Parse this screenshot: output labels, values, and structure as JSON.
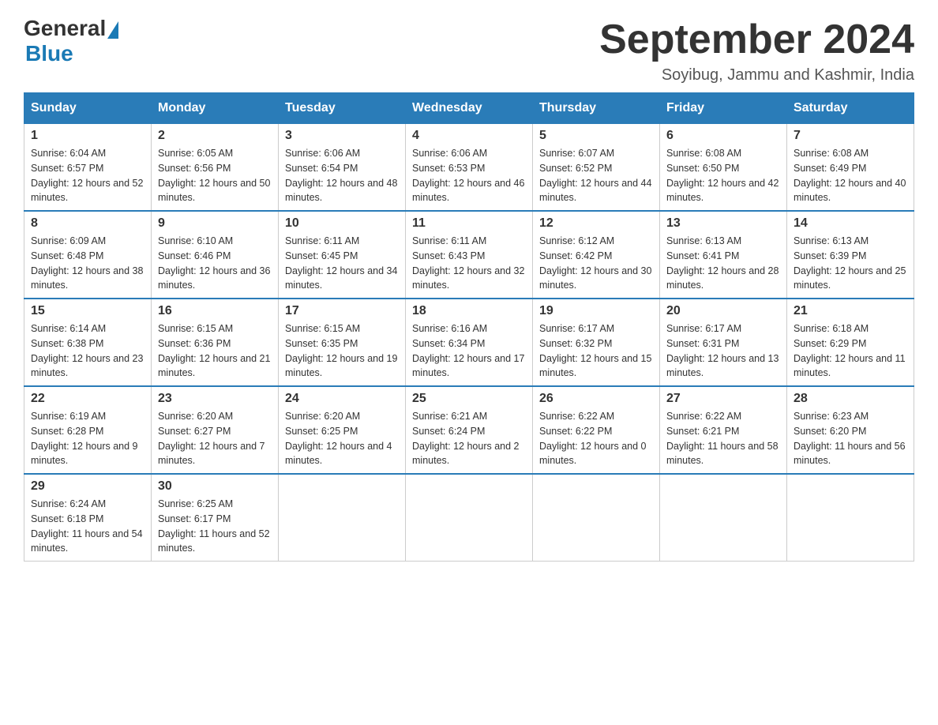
{
  "header": {
    "logo_general": "General",
    "logo_blue": "Blue",
    "month_title": "September 2024",
    "location": "Soyibug, Jammu and Kashmir, India"
  },
  "days_of_week": [
    "Sunday",
    "Monday",
    "Tuesday",
    "Wednesday",
    "Thursday",
    "Friday",
    "Saturday"
  ],
  "weeks": [
    [
      {
        "day": "1",
        "sunrise": "6:04 AM",
        "sunset": "6:57 PM",
        "daylight": "12 hours and 52 minutes."
      },
      {
        "day": "2",
        "sunrise": "6:05 AM",
        "sunset": "6:56 PM",
        "daylight": "12 hours and 50 minutes."
      },
      {
        "day": "3",
        "sunrise": "6:06 AM",
        "sunset": "6:54 PM",
        "daylight": "12 hours and 48 minutes."
      },
      {
        "day": "4",
        "sunrise": "6:06 AM",
        "sunset": "6:53 PM",
        "daylight": "12 hours and 46 minutes."
      },
      {
        "day": "5",
        "sunrise": "6:07 AM",
        "sunset": "6:52 PM",
        "daylight": "12 hours and 44 minutes."
      },
      {
        "day": "6",
        "sunrise": "6:08 AM",
        "sunset": "6:50 PM",
        "daylight": "12 hours and 42 minutes."
      },
      {
        "day": "7",
        "sunrise": "6:08 AM",
        "sunset": "6:49 PM",
        "daylight": "12 hours and 40 minutes."
      }
    ],
    [
      {
        "day": "8",
        "sunrise": "6:09 AM",
        "sunset": "6:48 PM",
        "daylight": "12 hours and 38 minutes."
      },
      {
        "day": "9",
        "sunrise": "6:10 AM",
        "sunset": "6:46 PM",
        "daylight": "12 hours and 36 minutes."
      },
      {
        "day": "10",
        "sunrise": "6:11 AM",
        "sunset": "6:45 PM",
        "daylight": "12 hours and 34 minutes."
      },
      {
        "day": "11",
        "sunrise": "6:11 AM",
        "sunset": "6:43 PM",
        "daylight": "12 hours and 32 minutes."
      },
      {
        "day": "12",
        "sunrise": "6:12 AM",
        "sunset": "6:42 PM",
        "daylight": "12 hours and 30 minutes."
      },
      {
        "day": "13",
        "sunrise": "6:13 AM",
        "sunset": "6:41 PM",
        "daylight": "12 hours and 28 minutes."
      },
      {
        "day": "14",
        "sunrise": "6:13 AM",
        "sunset": "6:39 PM",
        "daylight": "12 hours and 25 minutes."
      }
    ],
    [
      {
        "day": "15",
        "sunrise": "6:14 AM",
        "sunset": "6:38 PM",
        "daylight": "12 hours and 23 minutes."
      },
      {
        "day": "16",
        "sunrise": "6:15 AM",
        "sunset": "6:36 PM",
        "daylight": "12 hours and 21 minutes."
      },
      {
        "day": "17",
        "sunrise": "6:15 AM",
        "sunset": "6:35 PM",
        "daylight": "12 hours and 19 minutes."
      },
      {
        "day": "18",
        "sunrise": "6:16 AM",
        "sunset": "6:34 PM",
        "daylight": "12 hours and 17 minutes."
      },
      {
        "day": "19",
        "sunrise": "6:17 AM",
        "sunset": "6:32 PM",
        "daylight": "12 hours and 15 minutes."
      },
      {
        "day": "20",
        "sunrise": "6:17 AM",
        "sunset": "6:31 PM",
        "daylight": "12 hours and 13 minutes."
      },
      {
        "day": "21",
        "sunrise": "6:18 AM",
        "sunset": "6:29 PM",
        "daylight": "12 hours and 11 minutes."
      }
    ],
    [
      {
        "day": "22",
        "sunrise": "6:19 AM",
        "sunset": "6:28 PM",
        "daylight": "12 hours and 9 minutes."
      },
      {
        "day": "23",
        "sunrise": "6:20 AM",
        "sunset": "6:27 PM",
        "daylight": "12 hours and 7 minutes."
      },
      {
        "day": "24",
        "sunrise": "6:20 AM",
        "sunset": "6:25 PM",
        "daylight": "12 hours and 4 minutes."
      },
      {
        "day": "25",
        "sunrise": "6:21 AM",
        "sunset": "6:24 PM",
        "daylight": "12 hours and 2 minutes."
      },
      {
        "day": "26",
        "sunrise": "6:22 AM",
        "sunset": "6:22 PM",
        "daylight": "12 hours and 0 minutes."
      },
      {
        "day": "27",
        "sunrise": "6:22 AM",
        "sunset": "6:21 PM",
        "daylight": "11 hours and 58 minutes."
      },
      {
        "day": "28",
        "sunrise": "6:23 AM",
        "sunset": "6:20 PM",
        "daylight": "11 hours and 56 minutes."
      }
    ],
    [
      {
        "day": "29",
        "sunrise": "6:24 AM",
        "sunset": "6:18 PM",
        "daylight": "11 hours and 54 minutes."
      },
      {
        "day": "30",
        "sunrise": "6:25 AM",
        "sunset": "6:17 PM",
        "daylight": "11 hours and 52 minutes."
      },
      null,
      null,
      null,
      null,
      null
    ]
  ]
}
